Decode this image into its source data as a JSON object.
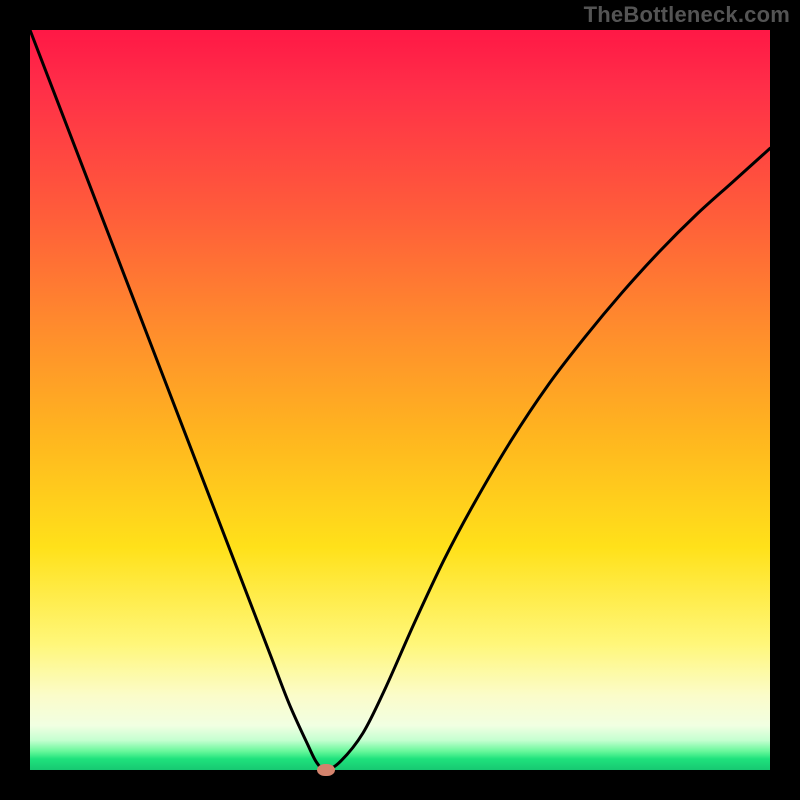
{
  "watermark": "TheBottleneck.com",
  "chart_data": {
    "type": "line",
    "title": "",
    "xlabel": "",
    "ylabel": "",
    "xlim": [
      0,
      100
    ],
    "ylim": [
      0,
      100
    ],
    "grid": false,
    "series": [
      {
        "name": "bottleneck-curve",
        "x": [
          0,
          5,
          10,
          15,
          20,
          25,
          30,
          32.5,
          35,
          37.5,
          38.75,
          40,
          42,
          45,
          48,
          52,
          56,
          60,
          65,
          70,
          75,
          80,
          85,
          90,
          95,
          100
        ],
        "values": [
          100,
          87,
          74,
          61,
          48,
          35,
          22,
          15.5,
          9,
          3.5,
          1,
          0,
          1.2,
          5,
          11,
          20,
          28.5,
          36,
          44.5,
          52,
          58.5,
          64.5,
          70,
          75,
          79.5,
          84
        ]
      }
    ],
    "marker": {
      "x": 40,
      "y": 0,
      "label": "optimal-point"
    },
    "colors": {
      "curve": "#000000",
      "marker": "#d4836d",
      "gradient_top": "#ff1846",
      "gradient_bottom": "#17c872",
      "frame": "#000000"
    }
  }
}
